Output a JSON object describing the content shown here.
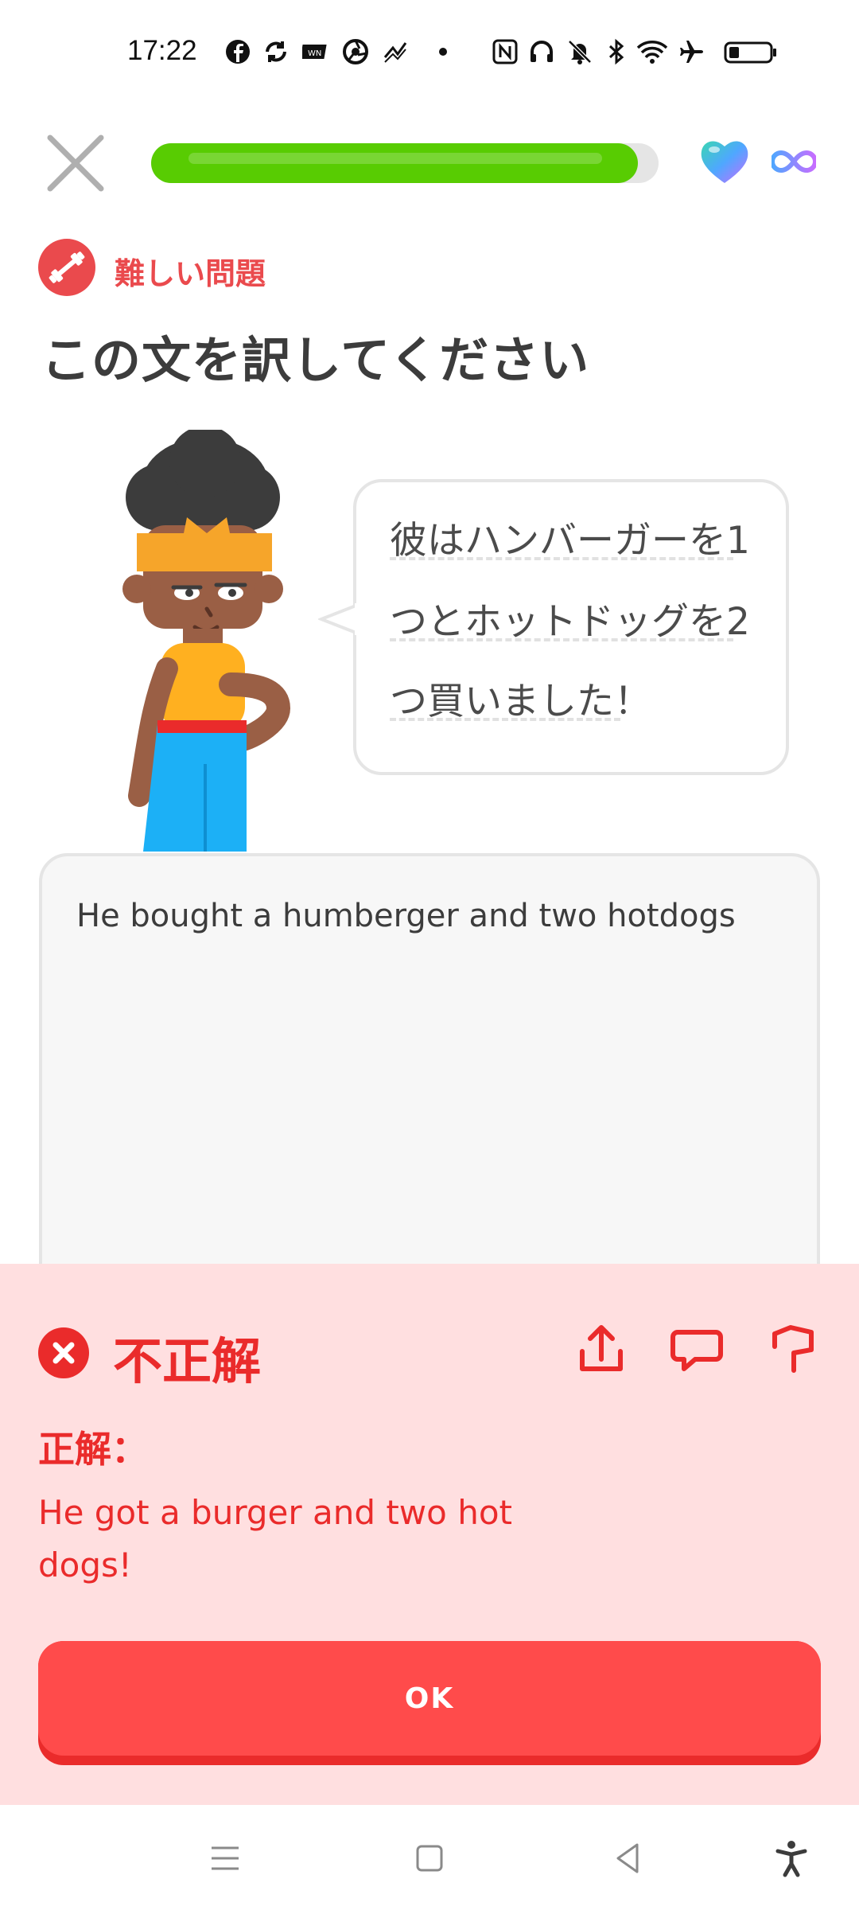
{
  "status_bar": {
    "time": "17:22",
    "icons": [
      "facebook-icon",
      "sync-icon",
      "news-icon",
      "browser-icon",
      "signal-app-icon",
      "dot-icon",
      "nfc-icon",
      "headphones-icon",
      "mute-icon",
      "bluetooth-icon",
      "wifi-icon",
      "airplane-icon",
      "battery-icon"
    ]
  },
  "lesson": {
    "progress": 0.96,
    "hearts": "infinity",
    "badge_label": "難しい問題",
    "prompt": "この文を訳してください",
    "sentence_lines": [
      "彼はハンバーガーを1",
      "つとホットドッグを2",
      "つ買いました！"
    ],
    "answer_input": "He bought a humberger and two hotdogs"
  },
  "feedback": {
    "status": "不正解",
    "correct_label": "正解：",
    "correct_answer": "He got a burger and two hot dogs!",
    "actions": [
      "share-icon",
      "comment-icon",
      "report-flag-icon"
    ],
    "ok_label": "OK"
  },
  "colors": {
    "green": "#58cc02",
    "red": "#ea2b2b",
    "red_button": "#ff4b4b",
    "feedback_bg": "#ffdfe0"
  },
  "nav": [
    "menu-icon",
    "home-icon",
    "back-icon",
    "accessibility-icon"
  ]
}
